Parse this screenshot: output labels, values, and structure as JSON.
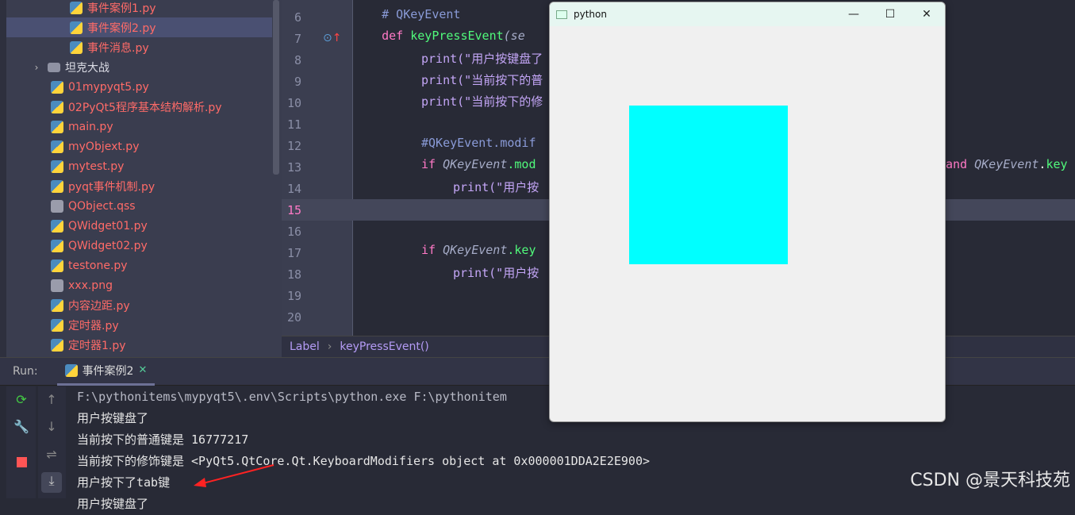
{
  "project_tree": [
    {
      "label": "事件案例1.py",
      "type": "py",
      "indent": 2
    },
    {
      "label": "事件案例2.py",
      "type": "py",
      "indent": 2,
      "selected": true
    },
    {
      "label": "事件消息.py",
      "type": "py",
      "indent": 2
    },
    {
      "label": "坦克大战",
      "type": "dir",
      "indent": 1
    },
    {
      "label": "01mypyqt5.py",
      "type": "py",
      "indent": 1
    },
    {
      "label": "02PyQt5程序基本结构解析.py",
      "type": "py",
      "indent": 1
    },
    {
      "label": "main.py",
      "type": "py",
      "indent": 1
    },
    {
      "label": "myObjext.py",
      "type": "py",
      "indent": 1
    },
    {
      "label": "mytest.py",
      "type": "py",
      "indent": 1
    },
    {
      "label": "pyqt事件机制.py",
      "type": "py",
      "indent": 1
    },
    {
      "label": "QObject.qss",
      "type": "file",
      "indent": 1
    },
    {
      "label": "QWidget01.py",
      "type": "py",
      "indent": 1
    },
    {
      "label": "QWidget02.py",
      "type": "py",
      "indent": 1
    },
    {
      "label": "testone.py",
      "type": "py",
      "indent": 1
    },
    {
      "label": "xxx.png",
      "type": "file",
      "indent": 1
    },
    {
      "label": "内容边距.py",
      "type": "py",
      "indent": 1
    },
    {
      "label": "定时器.py",
      "type": "py",
      "indent": 1
    },
    {
      "label": "定时器1.py",
      "type": "py",
      "indent": 1
    }
  ],
  "editor": {
    "line_numbers": [
      "6",
      "7",
      "8",
      "9",
      "10",
      "11",
      "12",
      "13",
      "14",
      "15",
      "16",
      "17",
      "18",
      "19",
      "20"
    ],
    "current_line": "15",
    "breadcrumb": [
      "Label",
      "keyPressEvent()"
    ],
    "code": {
      "l6": "    # QKeyEvent",
      "l7_kw": "    def ",
      "l7_fn": "keyPressEvent",
      "l7_rest": "(se",
      "l8": "print(\"用户按键盘了",
      "l9": "print(\"当前按下的普",
      "l10": "print(\"当前按下的修",
      "l12": "#QKeyEvent.modif",
      "l13_a": "QKeyEvent",
      "l13_b": ".mod",
      "l13_c": "and ",
      "l13_d": "QKeyEvent",
      ".": ".",
      "l13_e": "key",
      "l14": "print(\"用户按",
      "l17_a": "QKeyEvent",
      "l17_b": ".key",
      "l18": "print(\"用户按",
      "kw_if": "if ",
      "kw_print": "print"
    }
  },
  "run": {
    "label": "Run:",
    "tab": "事件案例2",
    "output": [
      "F:\\pythonitems\\mypyqt5\\.env\\Scripts\\python.exe F:\\pythonitem",
      "用户按键盘了",
      "当前按下的普通键是 16777217",
      "当前按下的修饰键是 <PyQt5.QtCore.Qt.KeyboardModifiers object at 0x000001DDA2E2E900>",
      "用户按下了tab键",
      "用户按键盘了"
    ]
  },
  "python_window": {
    "title": "python",
    "rect_color": "#00ffff",
    "minimize": "—",
    "maximize": "☐",
    "close": "✕"
  },
  "watermark": "CSDN @景天科技苑"
}
